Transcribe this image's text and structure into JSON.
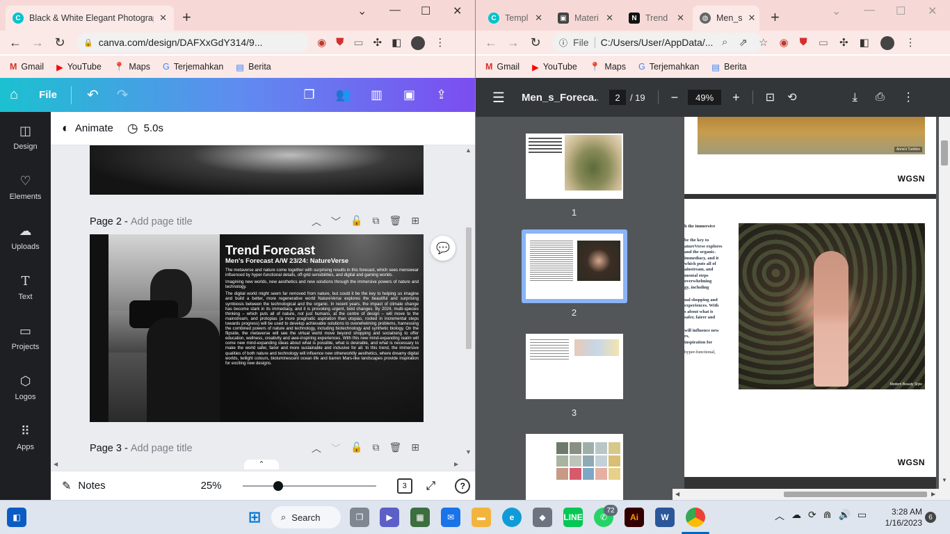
{
  "left_browser": {
    "tabs": [
      {
        "title": "Black & White Elegant Photograp",
        "close": "✕"
      }
    ],
    "new_tab": "+",
    "url": "canva.com/design/DAFXxGdY314/9...",
    "bookmarks": [
      "Gmail",
      "YouTube",
      "Maps",
      "Terjemahkan",
      "Berita"
    ],
    "win_controls": {
      "collapse": "⌄",
      "minimize": "—",
      "maximize": "☐",
      "close": "✕"
    }
  },
  "canva": {
    "file_label": "File",
    "animate_label": "Animate",
    "duration": "5.0s",
    "sidebar": [
      {
        "label": "Design",
        "icon": "design-icon"
      },
      {
        "label": "Elements",
        "icon": "elements-icon"
      },
      {
        "label": "Uploads",
        "icon": "uploads-icon"
      },
      {
        "label": "Text",
        "icon": "text-icon"
      },
      {
        "label": "Projects",
        "icon": "projects-icon"
      },
      {
        "label": "Logos",
        "icon": "logos-icon"
      },
      {
        "label": "Apps",
        "icon": "apps-icon"
      }
    ],
    "page2_label": "Page 2 -",
    "page3_label": "Page 3 -",
    "page_title_placeholder": "Add page title",
    "page_content": {
      "heading": "Trend Forecast",
      "subheading": "Men's Forecast A/W 23/24: NatureVerse",
      "paragraphs": [
        "The metaverse and nature come together with surprising results in this forecast, which sees menswear influenced by hyper-functional details, off-grid sensibilities, and digital and gaming worlds.",
        "Imagining new worlds, new aesthetics and new solutions through the immersive powers of nature and technology.",
        "The digital world might seem far removed from nature, but could it be the key to helping us imagine and build a better, more regenerative world NatureVerse explores the beautiful and surprising symbiosis between the technological and the organic. In recent years, the impact of climate change has become stark in its immediacy, and it is provoking urgent, bold changes. By 2024, multi-species thinking – which puts all of nature, not just humans, at the centre of design – will move to the mainstream, and protopias (a more pragmatic aspiration than utopias, rooted in incremental steps towards progress) will be used to develop achievable solutions to overwhelming problems, harnessing the combined powers of nature and technology, including biotechnology and synthetic biology. On the flipside, the metaverse will see the virtual world move beyond shopping and socialising to offer education, wellness, creativity and awe-inspiring experiences. With this new mind-expanding realm will come new mind-expanding ideas about what is possible, what is desirable, and what is necessary to make the world safer, fairer and more sustainable and inclusive for all. In this trend, the immersive qualities of both nature and technology will influence new otherworldly aesthetics, where dreamy digital worlds, twilight colours, bioluminescent ocean life and barren Mars-like landscapes provide inspiration for exciting new designs."
      ]
    },
    "notes_label": "Notes",
    "zoom": "25%",
    "zoom_fraction": 0.25,
    "page_count": "3",
    "help": "?"
  },
  "right_browser": {
    "tabs": [
      {
        "title": "Templ",
        "close": "✕"
      },
      {
        "title": "Materi",
        "close": "✕"
      },
      {
        "title": "Trend",
        "close": "✕"
      },
      {
        "title": "Men_s",
        "close": "✕"
      }
    ],
    "new_tab": "+",
    "url_prefix": "File",
    "url": "C:/Users/User/AppData/...",
    "bookmarks": [
      "Gmail",
      "YouTube",
      "Maps",
      "Terjemahkan",
      "Berita"
    ],
    "win_controls": {
      "collapse": "⌄",
      "minimize": "—",
      "maximize": "☐",
      "close": "✕"
    }
  },
  "pdf": {
    "filename": "Men_s_Foreca...",
    "current_page": "2",
    "total_pages": "/ 19",
    "zoom": "49%",
    "thumbs": [
      "1",
      "2",
      "3"
    ],
    "page1_caption": "Anna's Tuddice",
    "brand": "WGSN",
    "photo_caption": "Modern Beauty Style",
    "partial_text": [
      "h the immersive",
      "be the key to",
      "atureVerse explores",
      "and the organic.",
      "immediacy, and it",
      "which puts all of",
      "ainstream, and",
      "mental steps",
      "overwhelming",
      "gy, including",
      "ual shopping and",
      "experiences. With",
      "s about what is",
      "safer, fairer and",
      "will influence new",
      "rs,",
      "inspiration for",
      "hyper-functional,"
    ]
  },
  "taskbar": {
    "search_label": "Search",
    "whatsapp_badge": "72",
    "time": "3:28 AM",
    "date": "1/16/2023",
    "notification_count": "6"
  }
}
